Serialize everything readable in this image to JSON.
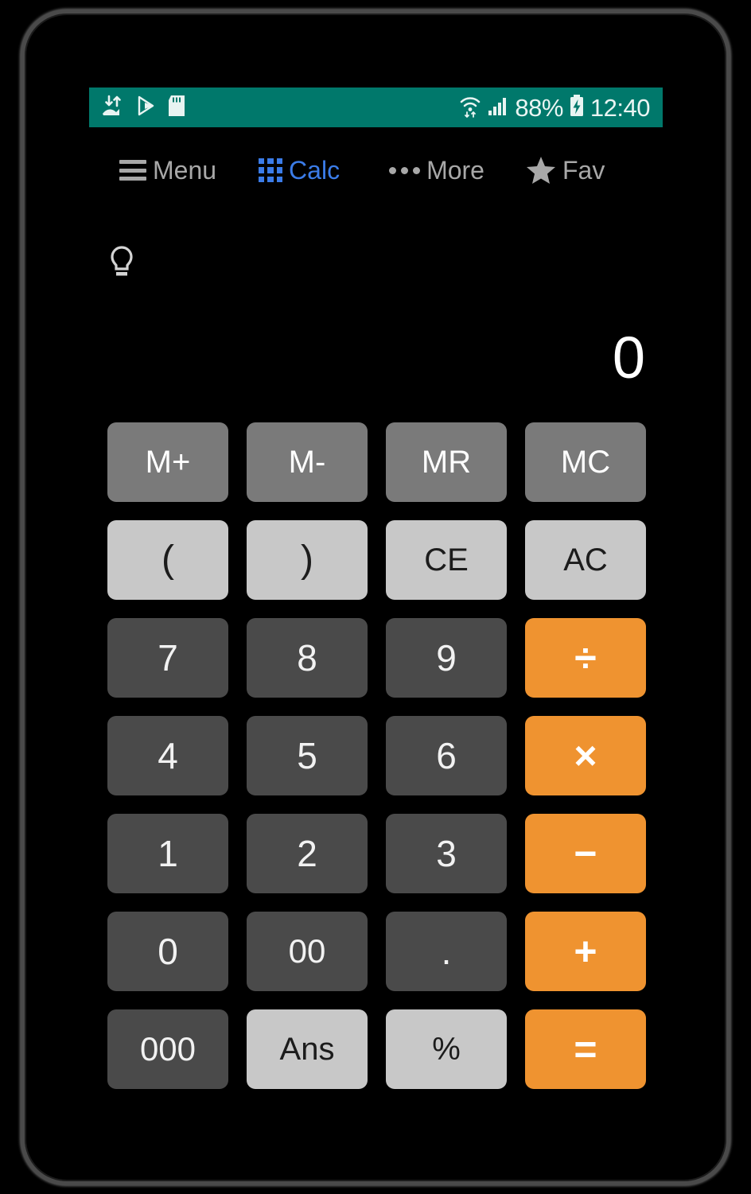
{
  "status_bar": {
    "icons_left": [
      "data-transfer-icon",
      "play-store-icon",
      "sd-card-icon"
    ],
    "wifi_icon": "wifi-icon",
    "signal_icon": "signal-bars-icon",
    "battery_percent": "88%",
    "battery_icon": "battery-charging-icon",
    "time": "12:40",
    "background_color": "#00786b"
  },
  "nav_bar": {
    "items": [
      {
        "id": "menu",
        "label": "Menu",
        "icon": "hamburger-icon",
        "active": false
      },
      {
        "id": "calc",
        "label": "Calc",
        "icon": "grid-icon",
        "active": true
      },
      {
        "id": "more",
        "label": "More",
        "icon": "dots-icon",
        "active": false
      },
      {
        "id": "fav",
        "label": "Fav",
        "icon": "star-icon",
        "active": false
      }
    ],
    "active_color": "#3b7ce8",
    "inactive_color": "#a8a8a8"
  },
  "hint": {
    "icon": "lightbulb-icon"
  },
  "display": {
    "value": "0"
  },
  "keypad": {
    "colors": {
      "memory": "#7a7a7a",
      "light": "#c8c8c8",
      "digit": "#4a4a4a",
      "operator": "#ef9330"
    },
    "keys": [
      {
        "name": "key-memory-add",
        "label": "M+",
        "style": "k-mem"
      },
      {
        "name": "key-memory-subtract",
        "label": "M-",
        "style": "k-mem"
      },
      {
        "name": "key-memory-recall",
        "label": "MR",
        "style": "k-mem"
      },
      {
        "name": "key-memory-clear",
        "label": "MC",
        "style": "k-mem"
      },
      {
        "name": "key-paren-open",
        "label": "(",
        "style": "k-light k-paren"
      },
      {
        "name": "key-paren-close",
        "label": ")",
        "style": "k-light k-paren"
      },
      {
        "name": "key-clear-entry",
        "label": "CE",
        "style": "k-light"
      },
      {
        "name": "key-all-clear",
        "label": "AC",
        "style": "k-light"
      },
      {
        "name": "key-7",
        "label": "7",
        "style": "k-dark"
      },
      {
        "name": "key-8",
        "label": "8",
        "style": "k-dark"
      },
      {
        "name": "key-9",
        "label": "9",
        "style": "k-dark"
      },
      {
        "name": "key-divide",
        "label": "÷",
        "style": "k-op sym"
      },
      {
        "name": "key-4",
        "label": "4",
        "style": "k-dark"
      },
      {
        "name": "key-5",
        "label": "5",
        "style": "k-dark"
      },
      {
        "name": "key-6",
        "label": "6",
        "style": "k-dark"
      },
      {
        "name": "key-multiply",
        "label": "×",
        "style": "k-op sym"
      },
      {
        "name": "key-1",
        "label": "1",
        "style": "k-dark"
      },
      {
        "name": "key-2",
        "label": "2",
        "style": "k-dark"
      },
      {
        "name": "key-3",
        "label": "3",
        "style": "k-dark"
      },
      {
        "name": "key-subtract",
        "label": "−",
        "style": "k-op sym"
      },
      {
        "name": "key-0",
        "label": "0",
        "style": "k-dark"
      },
      {
        "name": "key-00",
        "label": "00",
        "style": "k-dark small"
      },
      {
        "name": "key-decimal-point",
        "label": ".",
        "style": "k-dark k-dot"
      },
      {
        "name": "key-add",
        "label": "+",
        "style": "k-op sym"
      },
      {
        "name": "key-000",
        "label": "000",
        "style": "k-dark small"
      },
      {
        "name": "key-answer",
        "label": "Ans",
        "style": "k-light small"
      },
      {
        "name": "key-percent",
        "label": "%",
        "style": "k-light small"
      },
      {
        "name": "key-equals",
        "label": "=",
        "style": "k-op sym"
      }
    ]
  }
}
